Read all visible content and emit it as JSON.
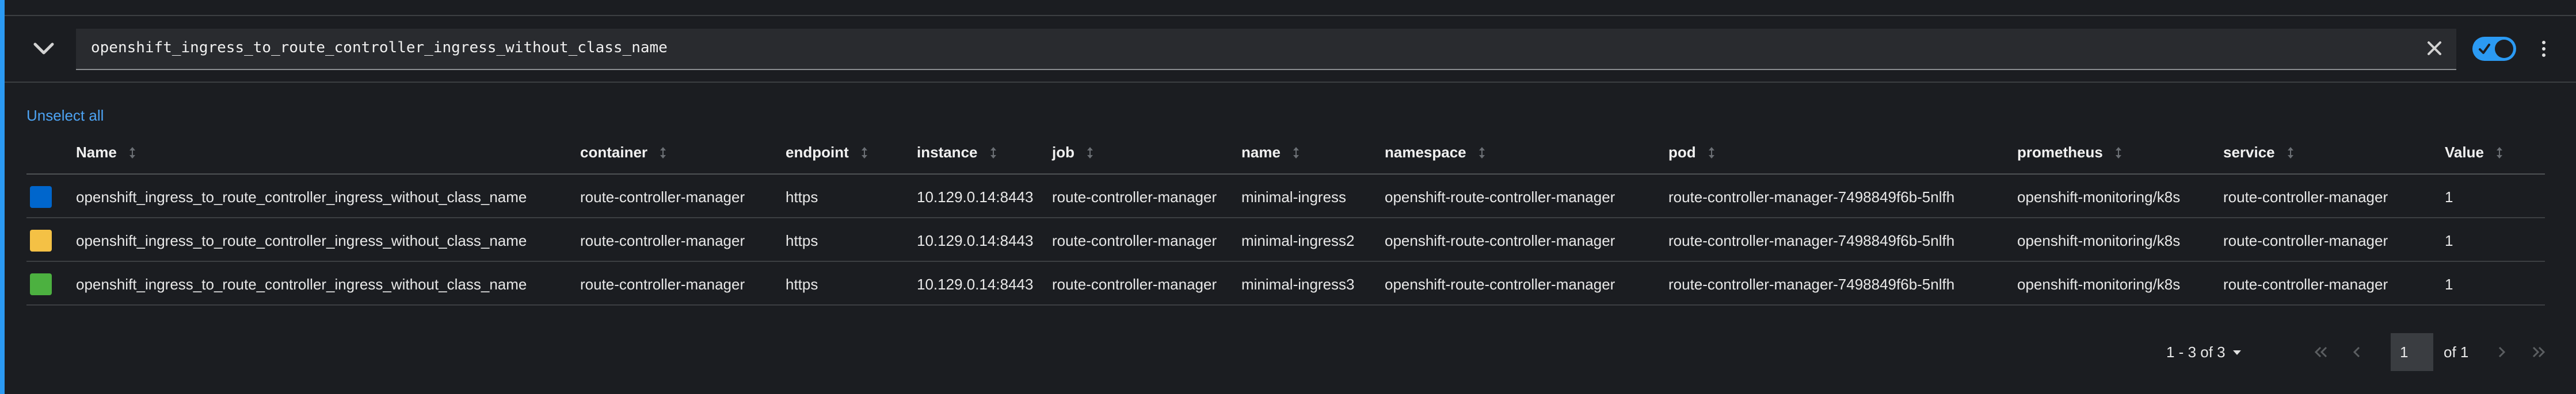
{
  "query": {
    "expression": "openshift_ingress_to_route_controller_ingress_without_class_name",
    "icons": {
      "expand": "chevron-down-icon",
      "clear": "close-icon",
      "menu": "kebab-icon"
    },
    "enabled": true
  },
  "unselect_all_label": "Unselect all",
  "table": {
    "columns": [
      "Name",
      "container",
      "endpoint",
      "instance",
      "job",
      "name",
      "namespace",
      "pod",
      "prometheus",
      "service",
      "Value"
    ],
    "rows": [
      {
        "color": "#0066cc",
        "cells": [
          "openshift_ingress_to_route_controller_ingress_without_class_name",
          "route-controller-manager",
          "https",
          "10.129.0.14:8443",
          "route-controller-manager",
          "minimal-ingress",
          "openshift-route-controller-manager",
          "route-controller-manager-7498849f6b-5nlfh",
          "openshift-monitoring/k8s",
          "route-controller-manager",
          "1"
        ]
      },
      {
        "color": "#f4c145",
        "cells": [
          "openshift_ingress_to_route_controller_ingress_without_class_name",
          "route-controller-manager",
          "https",
          "10.129.0.14:8443",
          "route-controller-manager",
          "minimal-ingress2",
          "openshift-route-controller-manager",
          "route-controller-manager-7498849f6b-5nlfh",
          "openshift-monitoring/k8s",
          "route-controller-manager",
          "1"
        ]
      },
      {
        "color": "#4cb140",
        "cells": [
          "openshift_ingress_to_route_controller_ingress_without_class_name",
          "route-controller-manager",
          "https",
          "10.129.0.14:8443",
          "route-controller-manager",
          "minimal-ingress3",
          "openshift-route-controller-manager",
          "route-controller-manager-7498849f6b-5nlfh",
          "openshift-monitoring/k8s",
          "route-controller-manager",
          "1"
        ]
      }
    ]
  },
  "pagination": {
    "range_label": "1 - 3 of 3",
    "page": "1",
    "of_label": "of 1"
  },
  "colors": {
    "accent": "#2b9af3",
    "background": "#1b1d21"
  }
}
